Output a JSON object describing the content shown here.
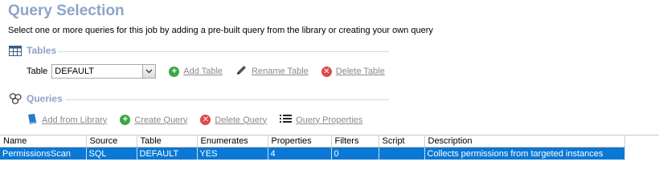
{
  "header": {
    "title": "Query Selection",
    "subtitle": "Select one or more queries for this job by adding a pre-built query from the library or creating your own query"
  },
  "tables_section": {
    "heading": "Tables",
    "table_label": "Table",
    "table_value": "DEFAULT",
    "add_label": "Add Table",
    "rename_label": "Rename Table",
    "delete_label": "Delete Table"
  },
  "queries_section": {
    "heading": "Queries",
    "add_library_label": "Add from Library",
    "create_label": "Create Query",
    "delete_label": "Delete Query",
    "properties_label": "Query Properties"
  },
  "grid": {
    "columns": [
      "Name",
      "Source",
      "Table",
      "Enumerates",
      "Properties",
      "Filters",
      "Script",
      "Description"
    ],
    "rows": [
      {
        "name": "PermissionsScan",
        "source": "SQL",
        "table": "DEFAULT",
        "enumerates": "YES",
        "properties": "4",
        "filters": "0",
        "script": "",
        "description": "Collects permissions from targeted instances",
        "selected": true
      }
    ]
  },
  "colors": {
    "accent": "#8ea4c8",
    "selection": "#0a78d4",
    "add": "#3aa845",
    "delete": "#e04848"
  }
}
